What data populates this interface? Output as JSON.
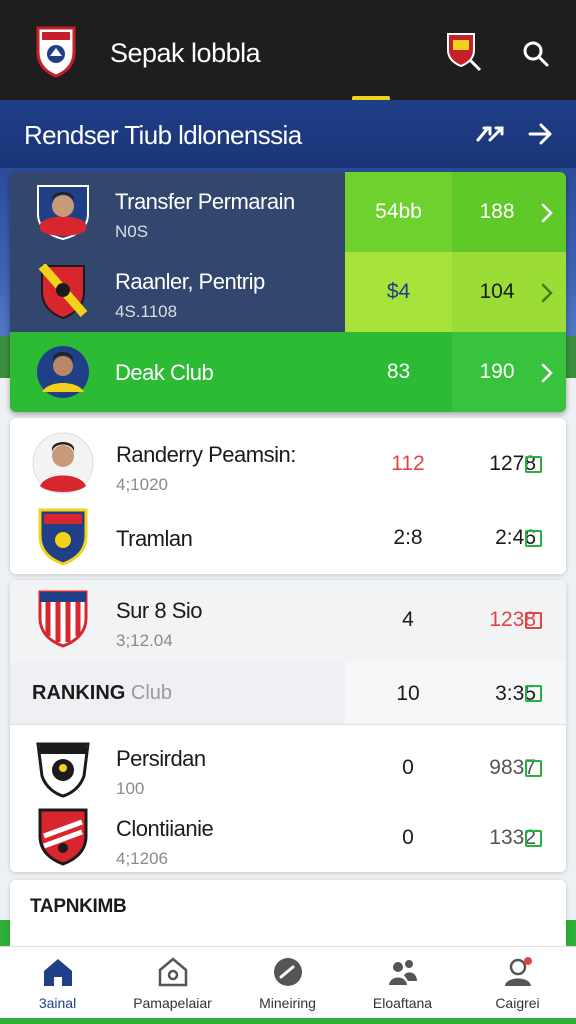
{
  "header": {
    "app_title": "Sepak lobbla",
    "section_title": "Rendser Tiub ldlonenssia"
  },
  "featured": [
    {
      "name": "Transfer Permarain",
      "sub": "N0S",
      "v1": "54bb",
      "v2": "188"
    },
    {
      "name": "Raanler, Pentrip",
      "sub": "4S.1108",
      "v1": "$4",
      "v2": "104"
    },
    {
      "name": "Deak Club",
      "sub": "",
      "v1": "83",
      "v2": "190"
    }
  ],
  "card1": [
    {
      "name": "Randerry Peamsin:",
      "sub": "4;1020",
      "v1": "112",
      "v2": "1278"
    },
    {
      "name": "Tramlan",
      "sub": "",
      "v1": "2:8",
      "v2": "2:46"
    }
  ],
  "card2": {
    "top": {
      "name": "Sur 8 Sio",
      "sub": "3;12.04",
      "v1": "4",
      "v2": "1238"
    },
    "ranking": {
      "label": "RANKING",
      "label_muted": "Club",
      "v1": "10",
      "v2": "3:35"
    },
    "rows": [
      {
        "name": "Persirdan",
        "sub": "100",
        "v1": "0",
        "v2": "9837"
      },
      {
        "name": "Clontiianie",
        "sub": "4;1206",
        "v1": "0",
        "v2": "1332"
      }
    ]
  },
  "bottom_section": {
    "label": "TAPNKIMB"
  },
  "nav": [
    {
      "label": "3ainal",
      "icon": "home-icon"
    },
    {
      "label": "Pamapelaiar",
      "icon": "stadium-icon"
    },
    {
      "label": "Mineiring",
      "icon": "whistle-icon"
    },
    {
      "label": "Eloaftana",
      "icon": "players-icon"
    },
    {
      "label": "Caigrei",
      "icon": "profile-icon"
    }
  ],
  "colors": {
    "header_bg": "#1e1e1e",
    "section_bg": "#1f3f87",
    "accent_yellow": "#f2d21b",
    "green": "#23b23c",
    "lime": "#7ad72a",
    "red": "#e04545"
  }
}
